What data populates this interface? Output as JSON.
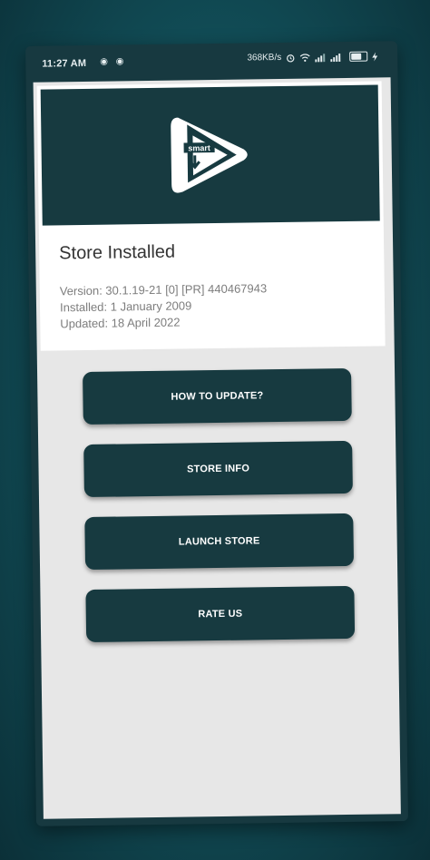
{
  "status_bar": {
    "time": "11:27 AM",
    "left_icons": "◉ ◉",
    "net_speed": "368KB/s",
    "battery_level": 0.75
  },
  "store": {
    "title": "Store Installed",
    "version": "Version: 30.1.19-21 [0] [PR] 440467943",
    "installed": "Installed: 1 January 2009",
    "updated": "Updated: 18 April 2022",
    "logo_text": "smart"
  },
  "buttons": {
    "how_to_update": "HOW TO UPDATE?",
    "store_info": "STORE INFO",
    "launch_store": "LAUNCH STORE",
    "rate_us": "RATE US"
  },
  "colors": {
    "accent": "#173a40",
    "background": "#0f4a52",
    "screen": "#e7e7e7"
  }
}
